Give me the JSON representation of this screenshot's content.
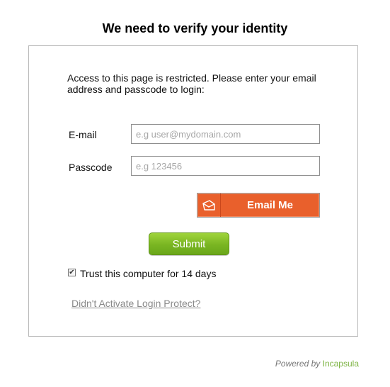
{
  "page": {
    "title": "We need to verify your identity"
  },
  "form": {
    "intro_line1": "Access to this page is restricted. Please enter your email",
    "intro_line2": "address and passcode to login:",
    "email_label": "E-mail",
    "email_placeholder": "e.g user@mydomain.com",
    "email_value": "",
    "passcode_label": "Passcode",
    "passcode_placeholder": "e.g 123456",
    "passcode_value": "",
    "email_me_label": "Email Me",
    "email_me_icon": "envelope-icon",
    "submit_label": "Submit",
    "trust_checked": true,
    "trust_label": "Trust this computer for 14 days",
    "help_link": "Didn't Activate Login Protect?"
  },
  "footer": {
    "powered_by": "Powered by",
    "brand": "Incapsula"
  },
  "colors": {
    "email_button": "#e9602c",
    "submit_button": "#79b522",
    "brand": "#7cb342"
  }
}
